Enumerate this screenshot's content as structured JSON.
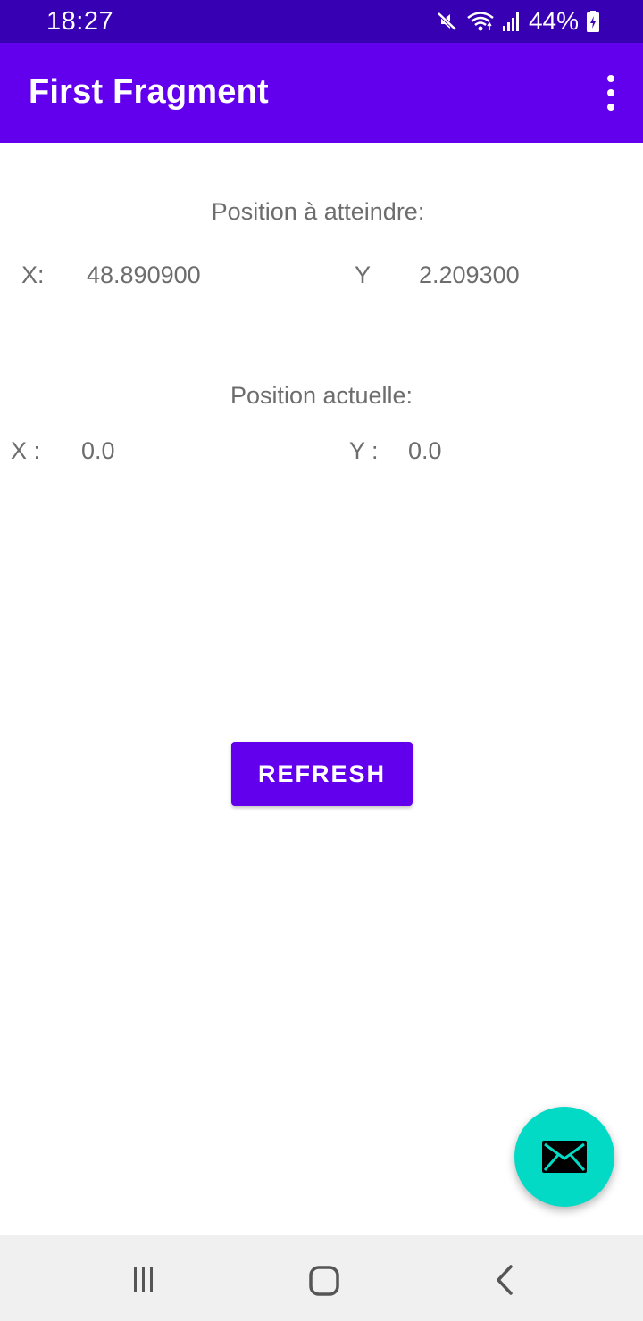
{
  "status_bar": {
    "time": "18:27",
    "battery_percent": "44%",
    "icons": [
      "mute-icon",
      "wifi-icon",
      "signal-icon",
      "battery-charging-icon"
    ]
  },
  "app_bar": {
    "title": "First Fragment",
    "menu_icon": "overflow-menu-icon"
  },
  "target_position": {
    "heading": "Position à atteindre:",
    "x_label": "X:",
    "x_value": "48.890900",
    "y_label": "Y",
    "y_value": "2.209300"
  },
  "current_position": {
    "heading": "Position actuelle:",
    "x_label": "X :",
    "x_value": "0.0",
    "y_label": "Y :",
    "y_value": "0.0"
  },
  "refresh_button": {
    "label": "REFRESH"
  },
  "fab": {
    "icon": "email-icon"
  },
  "nav_bar": {
    "icons": [
      "recents-icon",
      "home-icon",
      "back-icon"
    ]
  },
  "colors": {
    "status_bar": "#3700b3",
    "primary": "#6200ee",
    "fab": "#03dac5",
    "text": "#6d6d6d",
    "nav_bar": "#f0f0f0"
  }
}
